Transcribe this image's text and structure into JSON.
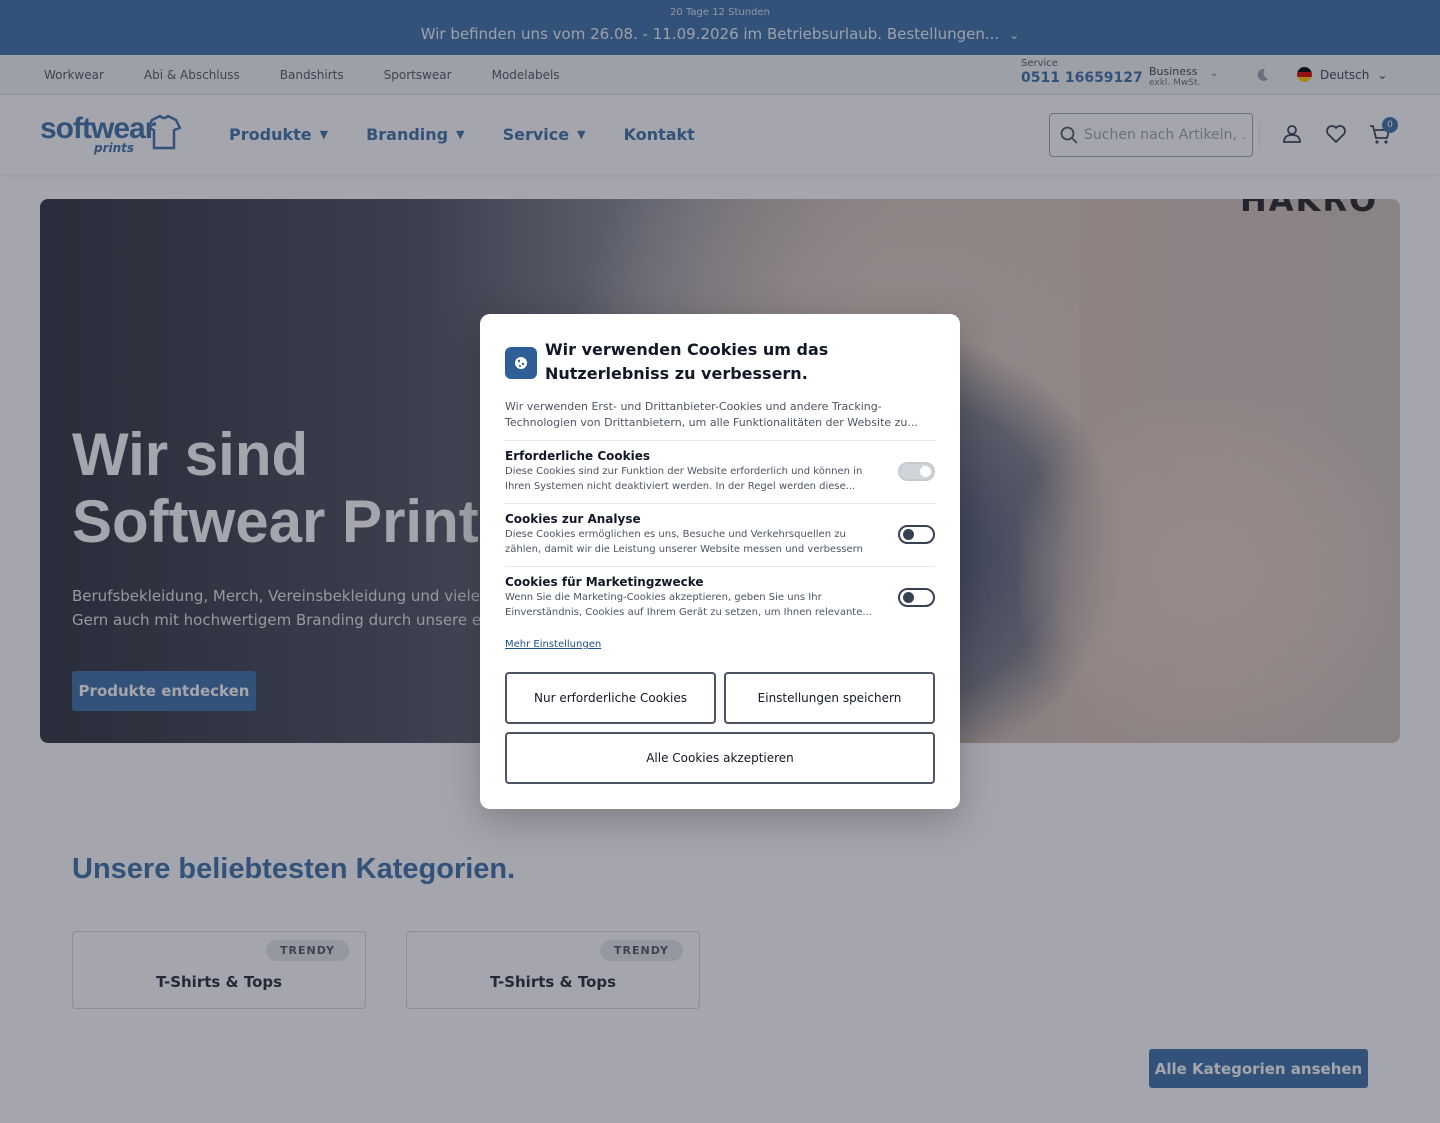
{
  "announcement": {
    "countdown": "20 Tage 12 Stunden",
    "message": "Wir befinden uns vom 26.08. - 11.09.2026 im Betriebsurlaub. Bestellungen..."
  },
  "utility": {
    "links": [
      "Workwear",
      "Abi & Abschluss",
      "Bandshirts",
      "Sportswear",
      "Modelabels"
    ],
    "service_label": "Service",
    "service_phone": "0511 16659127",
    "business_label": "Business",
    "business_sub": "exkl. MwSt.",
    "language": "Deutsch"
  },
  "header": {
    "logo_main": "softwear",
    "logo_sub": "prints",
    "nav": [
      {
        "label": "Produkte",
        "has_menu": true
      },
      {
        "label": "Branding",
        "has_menu": true
      },
      {
        "label": "Service",
        "has_menu": true
      },
      {
        "label": "Kontakt",
        "has_menu": false
      }
    ],
    "search_placeholder": "Suchen nach Artikeln, ...",
    "cart_count": "0"
  },
  "hero": {
    "brandmark": "HAKRO",
    "title_line1": "Wir sind",
    "title_line2": "Softwear Prints",
    "sub_line1": "Berufsbekleidung, Merch, Vereinsbekleidung und vieles",
    "sub_line2": "Gern auch mit hochwertigem Branding durch unsere ei",
    "cta": "Produkte entdecken"
  },
  "categories": {
    "title": "Unsere beliebtesten Kategorien.",
    "items": [
      {
        "badge": "TRENDY",
        "name": "T-Shirts & Tops"
      },
      {
        "badge": "TRENDY",
        "name": "T-Shirts & Tops"
      }
    ],
    "all_button": "Alle Kategorien ansehen"
  },
  "cookie": {
    "title": "Wir verwenden Cookies um das Nutzerlebniss zu verbessern.",
    "intro": "Wir verwenden Erst- und Drittanbieter-Cookies und andere Tracking-Technologien von Drittanbietern, um alle Funktionalitäten der Website zu...",
    "sections": [
      {
        "title": "Erforderliche Cookies",
        "desc": "Diese Cookies sind zur Funktion der Website erforderlich und können in Ihren Systemen nicht deaktiviert werden. In der Regel werden diese...",
        "enabled": true
      },
      {
        "title": "Cookies zur Analyse",
        "desc": "Diese Cookies ermöglichen es uns, Besuche und Verkehrsquellen zu zählen, damit wir die Leistung unserer Website messen und verbessern können. Si...",
        "enabled": false
      },
      {
        "title": "Cookies für Marketingzwecke",
        "desc": "Wenn Sie die Marketing-Cookies akzeptieren, geben Sie uns Ihr Einverständnis, Cookies auf Ihrem Gerät zu setzen, um Ihnen relevante...",
        "enabled": false
      }
    ],
    "more_settings": "Mehr Einstellungen",
    "btn_required": "Nur erforderliche Cookies",
    "btn_save": "Einstellungen speichern",
    "btn_accept_all": "Alle Cookies akzeptieren"
  },
  "colors": {
    "brand": "#3a6ea5",
    "announcement_bg": "#3a6ea5",
    "overlay": "rgba(40,44,60,0.42)"
  }
}
